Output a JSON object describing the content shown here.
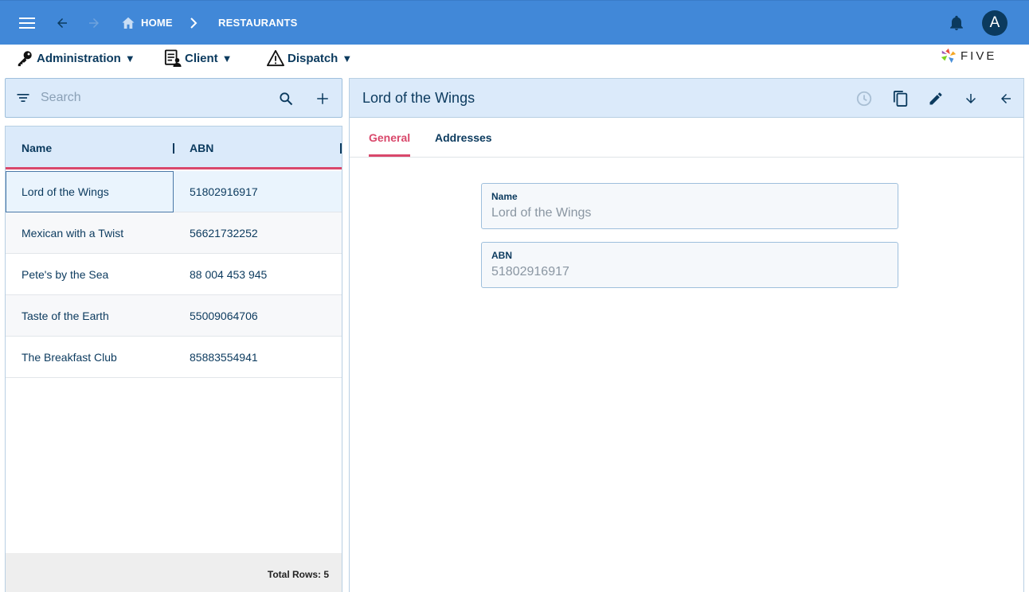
{
  "topbar": {
    "breadcrumbs": [
      "HOME",
      "RESTAURANTS"
    ],
    "avatar_initial": "A",
    "icons": [
      "menu-icon",
      "back-arrow-icon",
      "forward-arrow-icon",
      "home-icon",
      "chevron-right-icon",
      "bell-icon"
    ]
  },
  "menubar": {
    "items": [
      {
        "label": "Administration",
        "caret": "▼",
        "icon": "key-icon"
      },
      {
        "label": "Client",
        "caret": "▼",
        "icon": "client-doc-icon"
      },
      {
        "label": "Dispatch",
        "caret": "▼",
        "icon": "warning-icon"
      }
    ],
    "logo_text": "FIVE"
  },
  "search": {
    "placeholder": "Search"
  },
  "grid": {
    "columns": [
      "Name",
      "ABN"
    ],
    "rows": [
      {
        "name": "Lord of the Wings",
        "abn": "51802916917"
      },
      {
        "name": "Mexican with a Twist",
        "abn": "56621732252"
      },
      {
        "name": "Pete's by the Sea",
        "abn": "88 004 453 945"
      },
      {
        "name": "Taste of the Earth",
        "abn": "55009064706"
      },
      {
        "name": "The Breakfast Club",
        "abn": "85883554941"
      }
    ],
    "selected_index": 0,
    "footer": "Total Rows: 5"
  },
  "detail": {
    "title": "Lord of the Wings",
    "tabs": [
      "General",
      "Addresses"
    ],
    "active_tab": "General",
    "fields": [
      {
        "label": "Name",
        "value": "Lord of the Wings"
      },
      {
        "label": "ABN",
        "value": "51802916917"
      }
    ]
  },
  "colors": {
    "topbar": "#4188d8",
    "accent": "#d9486b",
    "navy": "#0b3a5e",
    "panel": "#dbeafa"
  }
}
